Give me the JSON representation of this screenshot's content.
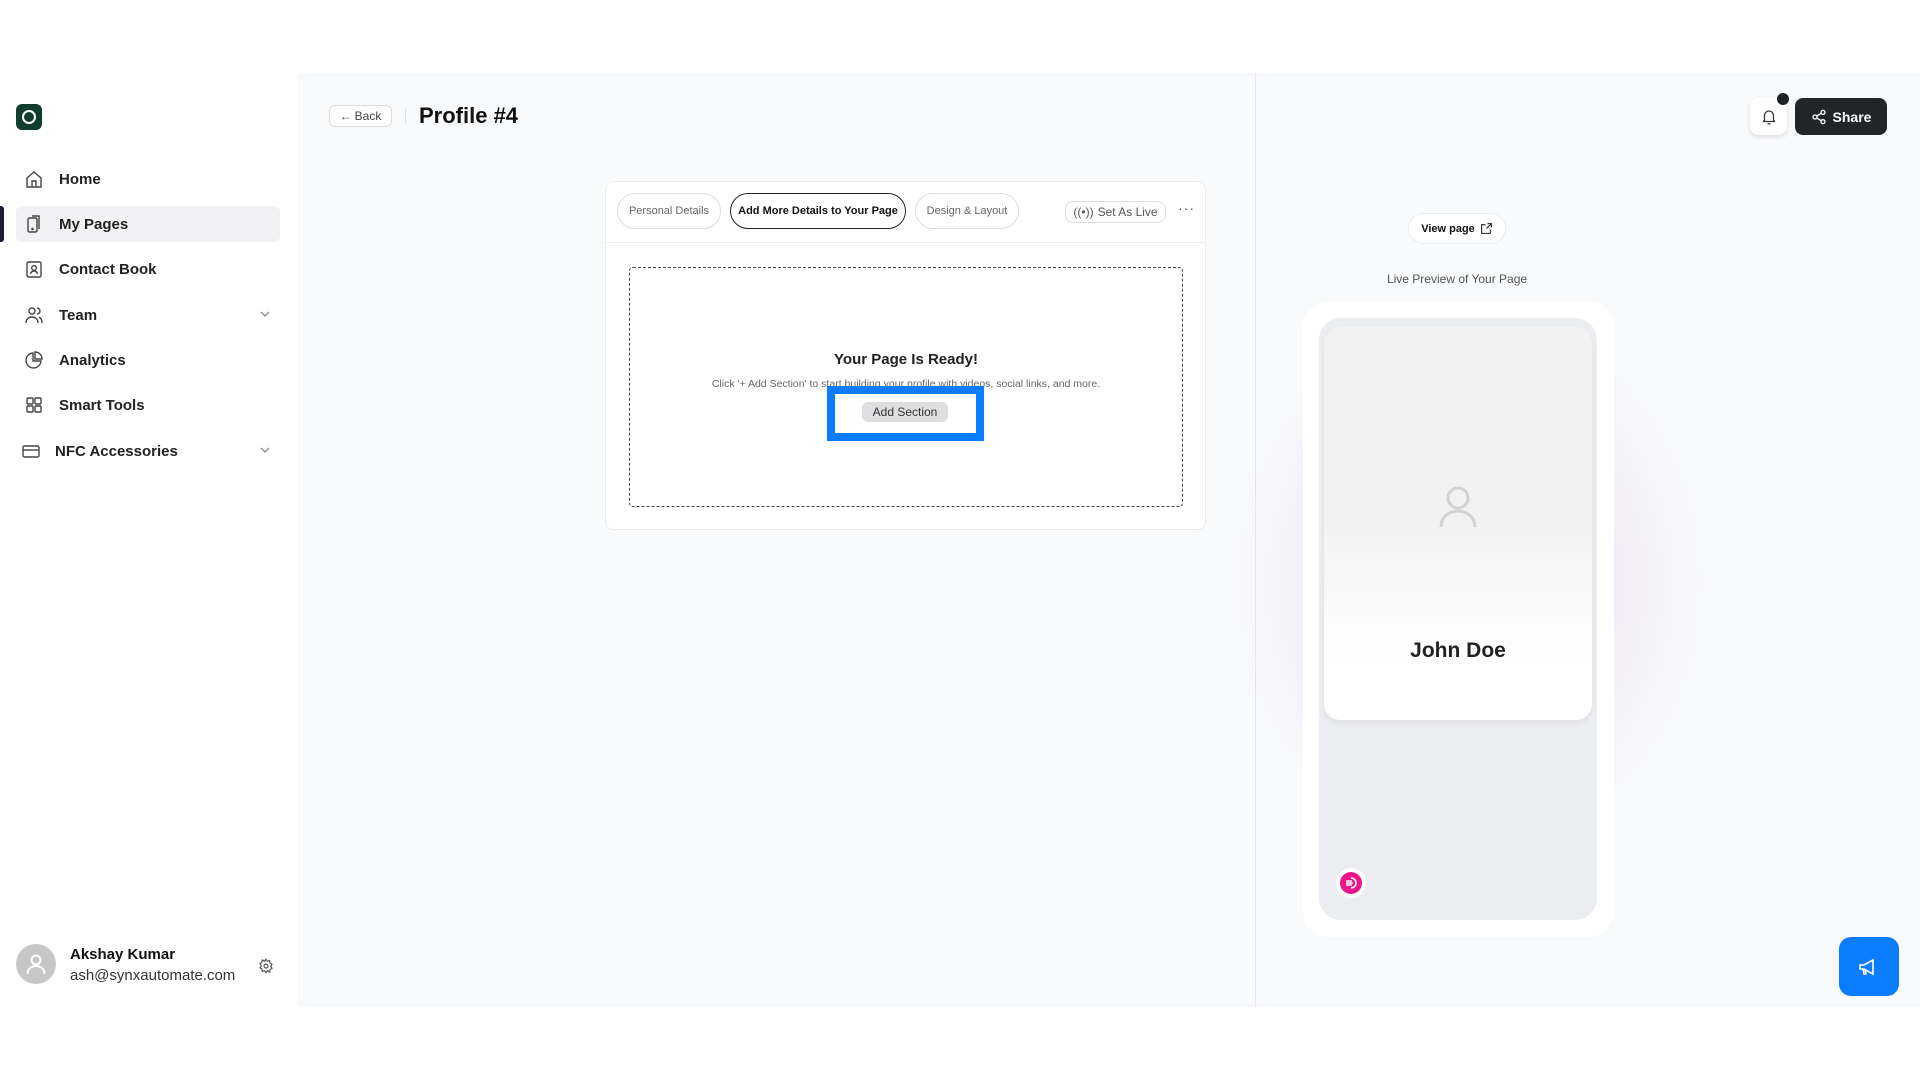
{
  "sidebar": {
    "items": [
      {
        "label": "Home",
        "icon": "home-icon"
      },
      {
        "label": "My Pages",
        "icon": "phone-icon",
        "active": true
      },
      {
        "label": "Contact Book",
        "icon": "contact-book-icon"
      },
      {
        "label": "Team",
        "icon": "team-icon",
        "expandable": true
      },
      {
        "label": "Analytics",
        "icon": "pie-chart-icon"
      },
      {
        "label": "Smart Tools",
        "icon": "grid-icon"
      },
      {
        "label": "NFC Accessories",
        "icon": "card-icon",
        "expandable": true
      }
    ],
    "user": {
      "name": "Akshay Kumar",
      "email": "ash@synxautomate.com"
    }
  },
  "header": {
    "back_label": "Back",
    "title": "Profile #4"
  },
  "editor": {
    "tabs": [
      {
        "label": "Personal Details"
      },
      {
        "label": "Add More Details to Your Page",
        "selected": true
      },
      {
        "label": "Design & Layout"
      }
    ],
    "set_live_label": "Set As Live",
    "more_label": "···",
    "empty_title": "Your Page Is Ready!",
    "empty_subtitle": "Click '+ Add Section' to start building your profile with videos, social links, and more.",
    "add_section_label": "Add Section"
  },
  "preview": {
    "share_label": "Share",
    "view_page_label": "View page",
    "caption": "Live Preview of Your Page",
    "name": "John Doe"
  },
  "colors": {
    "accent": "#0a7cff",
    "share_bg": "#212529",
    "pink": "#f0148c",
    "logo": "#0f3d2e"
  }
}
